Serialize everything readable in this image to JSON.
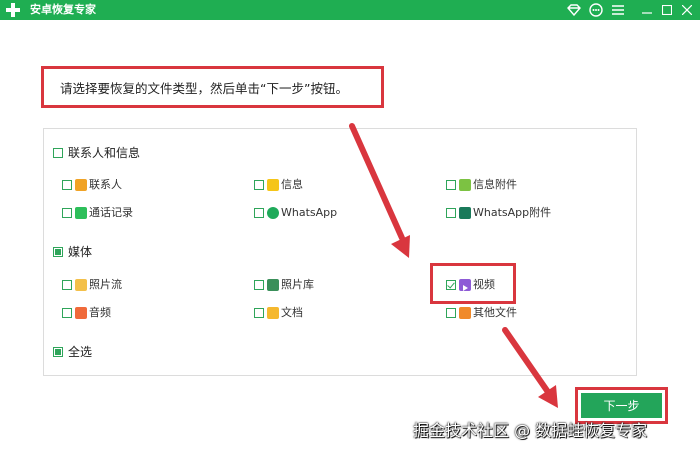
{
  "app": {
    "title": "安卓恢复专家"
  },
  "instruction": "请选择要恢复的文件类型，然后单击“下一步”按钮。",
  "groups": {
    "contacts": {
      "label": "联系人和信息",
      "items": [
        "联系人",
        "信息",
        "信息附件",
        "通话记录",
        "WhatsApp",
        "WhatsApp附件"
      ]
    },
    "media": {
      "label": "媒体",
      "items": [
        "照片流",
        "照片库",
        "视频",
        "音频",
        "文档",
        "其他文件"
      ]
    },
    "select_all": "全选"
  },
  "buttons": {
    "next": "下一步"
  },
  "watermark": "掘金技术社区 @ 数据蛙恢复专家",
  "colors": {
    "brand_green": "#1fae52",
    "highlight_red": "#d9363e"
  }
}
